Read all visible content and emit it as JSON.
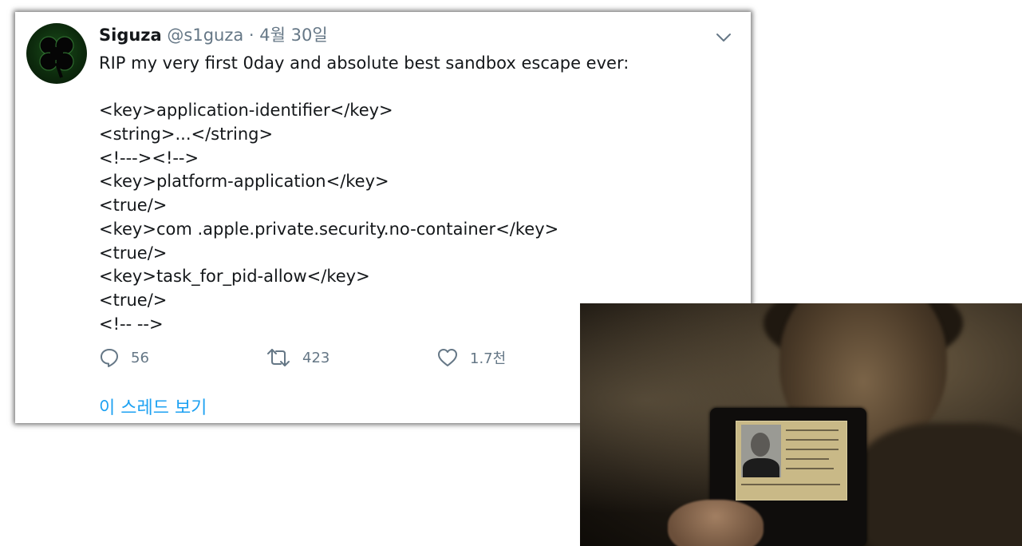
{
  "tweet": {
    "author_name": "Siguza",
    "author_handle": "@s1guza",
    "separator": "·",
    "date": "4월 30일",
    "lines": [
      "RIP my very first 0day and absolute best sandbox escape ever:",
      "",
      "<key>application-identifier</key>",
      "<string>...</string>",
      "<!---><!-->",
      "<key>platform-application</key>",
      "<true/>",
      "<key>com .apple.private.security.no-container</key>",
      "<true/>",
      "<key>task_for_pid-allow</key>",
      "<true/>",
      "<!-- -->"
    ],
    "actions": {
      "reply_count": "56",
      "retweet_count": "423",
      "like_count": "1.7천"
    },
    "thread_link": "이 스레드 보기"
  },
  "icons": {
    "avatar": "clover-avatar-icon",
    "menu": "chevron-down-icon",
    "reply": "reply-bubble-icon",
    "retweet": "retweet-icon",
    "like": "heart-icon"
  },
  "colors": {
    "link": "#1da1f2",
    "secondary_text": "#657786",
    "primary_text": "#14171a"
  }
}
